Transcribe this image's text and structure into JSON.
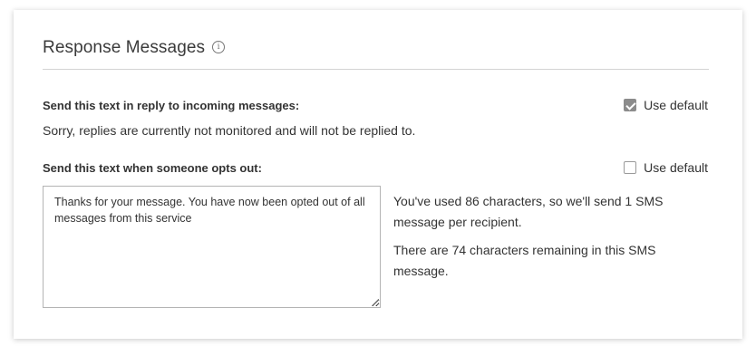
{
  "section": {
    "title": "Response Messages",
    "info_icon": "info-circle-icon"
  },
  "reply": {
    "label": "Send this text in reply to incoming messages:",
    "use_default_label": "Use default",
    "use_default_checked": true,
    "text": "Sorry, replies are currently not monitored and will not be replied to."
  },
  "optout": {
    "label": "Send this text when someone opts out:",
    "use_default_label": "Use default",
    "use_default_checked": false,
    "message": "Thanks for your message. You have now been opted out of all messages from this service",
    "usage_text": "You've used 86 characters, so we'll send 1 SMS message per recipient.",
    "remaining_text": "There are 74 characters remaining in this SMS message."
  },
  "colors": {
    "checkbox_checked": "#8c8c8c",
    "border": "#b4b4b4"
  }
}
